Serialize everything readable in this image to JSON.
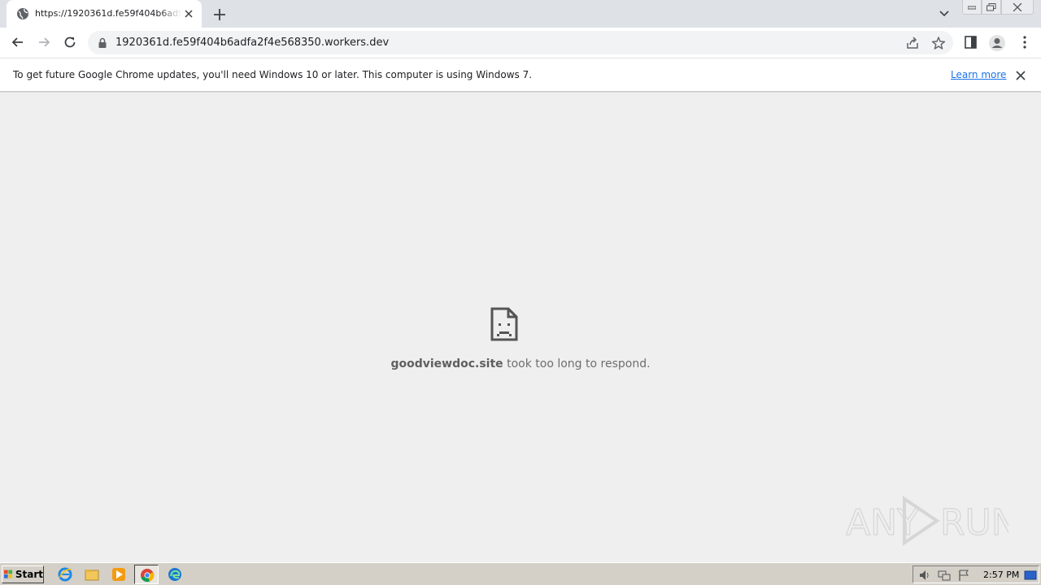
{
  "browser": {
    "tab": {
      "title": "https://1920361d.fe59f404b6adfa2f4e568350.workers.dev/",
      "favicon": "globe-icon"
    },
    "address_bar": {
      "url": "1920361d.fe59f404b6adfa2f4e568350.workers.dev"
    },
    "infobar": {
      "message": "To get future Google Chrome updates, you'll need Windows 10 or later. This computer is using Windows 7.",
      "link_label": "Learn more"
    },
    "colors": {
      "tabstrip": "#dee1e6",
      "link": "#1a73e8",
      "content_bg": "#efefef"
    }
  },
  "error_page": {
    "icon": "sad-document-icon",
    "host": "goodviewdoc.site",
    "message": " took too long to respond."
  },
  "watermark": {
    "text_left": "ANY",
    "text_right": "RUN"
  },
  "taskbar": {
    "start_label": "Start",
    "clock": "2:57 PM"
  }
}
